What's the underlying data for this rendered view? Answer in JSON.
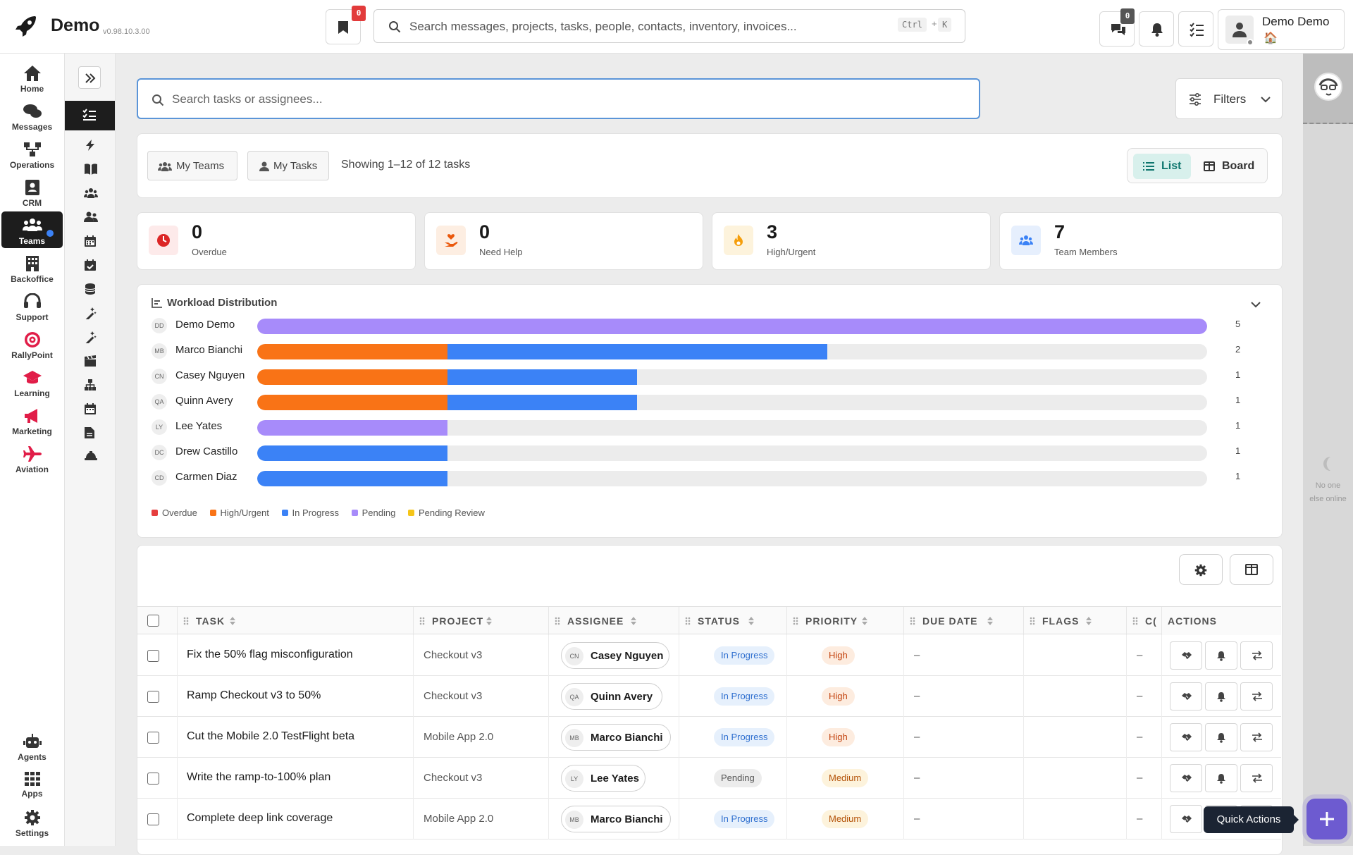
{
  "app": {
    "name": "Demo",
    "version": "v0.98.10.3.00"
  },
  "topbar": {
    "bookmark_badge": "0",
    "search_placeholder": "Search messages, projects, tasks, people, contacts, inventory, invoices...",
    "shortcut_ctrl": "Ctrl",
    "shortcut_plus": "+",
    "shortcut_key": "K",
    "messages_badge": "0",
    "user_name": "Demo Demo",
    "user_home_icon": "🏠"
  },
  "nav": {
    "items": [
      {
        "label": "Home",
        "icon": "home-icon"
      },
      {
        "label": "Messages",
        "icon": "messages-icon"
      },
      {
        "label": "Operations",
        "icon": "operations-icon"
      },
      {
        "label": "CRM",
        "icon": "crm-icon"
      },
      {
        "label": "Teams",
        "icon": "teams-icon"
      },
      {
        "label": "Backoffice",
        "icon": "backoffice-icon"
      },
      {
        "label": "Support",
        "icon": "support-icon"
      },
      {
        "label": "RallyPoint",
        "icon": "rallypoint-icon"
      },
      {
        "label": "Learning",
        "icon": "learning-icon"
      },
      {
        "label": "Marketing",
        "icon": "marketing-icon"
      },
      {
        "label": "Aviation",
        "icon": "aviation-icon"
      }
    ],
    "bottom": [
      {
        "label": "Agents",
        "icon": "agents-icon"
      },
      {
        "label": "Apps",
        "icon": "apps-icon"
      },
      {
        "label": "Settings",
        "icon": "settings-icon"
      }
    ]
  },
  "presence": {
    "text": "No one else online"
  },
  "task_search": {
    "placeholder": "Search tasks or assignees..."
  },
  "filters": {
    "label": "Filters"
  },
  "toolbar": {
    "my_teams": "My Teams",
    "my_tasks": "My Tasks",
    "showing": "Showing 1–12 of 12 tasks",
    "view_list": "List",
    "view_board": "Board"
  },
  "stats": [
    {
      "value": "0",
      "label": "Overdue",
      "color": "#dc2626",
      "bg": "#fdeaea"
    },
    {
      "value": "0",
      "label": "Need Help",
      "color": "#ea580c",
      "bg": "#fdeee2"
    },
    {
      "value": "3",
      "label": "High/Urgent",
      "color": "#f59e0b",
      "bg": "#fdf3dc"
    },
    {
      "value": "7",
      "label": "Team Members",
      "color": "#3b82f6",
      "bg": "#e6effd"
    }
  ],
  "workload": {
    "title": "Workload Distribution",
    "colors": {
      "overdue": "#e53e3e",
      "high": "#f97316",
      "progress": "#3b82f6",
      "pending": "#a78bfa",
      "review": "#f5c518"
    },
    "rows": [
      {
        "initials": "DD",
        "name": "Demo Demo",
        "count": "5",
        "high": 0,
        "progress": 0,
        "pending": 5
      },
      {
        "initials": "MB",
        "name": "Marco Bianchi",
        "count": "2",
        "high": 1,
        "progress": 2,
        "pending": 0
      },
      {
        "initials": "CN",
        "name": "Casey Nguyen",
        "count": "1",
        "high": 1,
        "progress": 1,
        "pending": 0
      },
      {
        "initials": "QA",
        "name": "Quinn Avery",
        "count": "1",
        "high": 1,
        "progress": 1,
        "pending": 0
      },
      {
        "initials": "LY",
        "name": "Lee Yates",
        "count": "1",
        "high": 0,
        "progress": 0,
        "pending": 1
      },
      {
        "initials": "DC",
        "name": "Drew Castillo",
        "count": "1",
        "high": 0,
        "progress": 1,
        "pending": 0
      },
      {
        "initials": "CD",
        "name": "Carmen Diaz",
        "count": "1",
        "high": 0,
        "progress": 1,
        "pending": 0
      }
    ],
    "legend": [
      "Overdue",
      "High/Urgent",
      "In Progress",
      "Pending",
      "Pending Review"
    ]
  },
  "table": {
    "columns": [
      "TASK",
      "PROJECT",
      "ASSIGNEE",
      "STATUS",
      "PRIORITY",
      "DUE DATE",
      "FLAGS",
      "C(",
      "ACTIONS"
    ],
    "rows": [
      {
        "task": "Fix the 50% flag misconfiguration",
        "project": "Checkout v3",
        "initials": "CN",
        "assignee": "Casey Nguyen",
        "status": "In Progress",
        "priority": "High",
        "due": "–",
        "c": "–"
      },
      {
        "task": "Ramp Checkout v3 to 50%",
        "project": "Checkout v3",
        "initials": "QA",
        "assignee": "Quinn Avery",
        "status": "In Progress",
        "priority": "High",
        "due": "–",
        "c": "–"
      },
      {
        "task": "Cut the Mobile 2.0 TestFlight beta",
        "project": "Mobile App 2.0",
        "initials": "MB",
        "assignee": "Marco Bianchi",
        "status": "In Progress",
        "priority": "High",
        "due": "–",
        "c": "–"
      },
      {
        "task": "Write the ramp-to-100% plan",
        "project": "Checkout v3",
        "initials": "LY",
        "assignee": "Lee Yates",
        "status": "Pending",
        "priority": "Medium",
        "due": "–",
        "c": "–"
      },
      {
        "task": "Complete deep link coverage",
        "project": "Mobile App 2.0",
        "initials": "MB",
        "assignee": "Marco Bianchi",
        "status": "In Progress",
        "priority": "Medium",
        "due": "–",
        "c": "–"
      }
    ]
  },
  "quick_actions": {
    "label": "Quick Actions"
  }
}
